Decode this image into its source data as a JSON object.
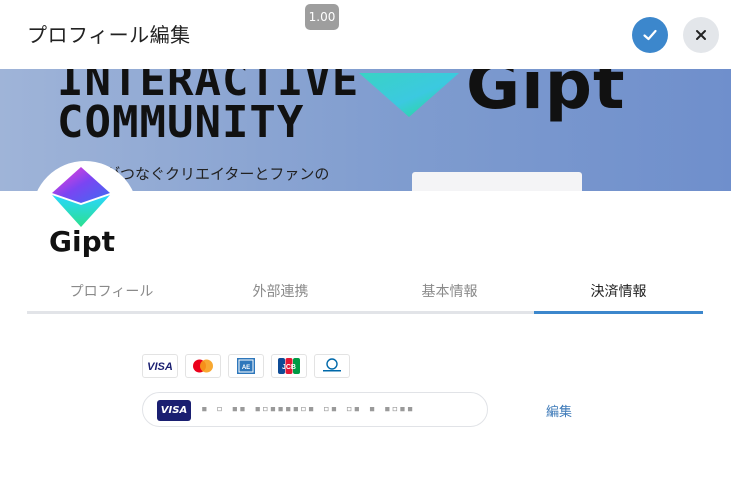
{
  "header": {
    "title": "プロフィール編集",
    "zoom_badge": "1.00",
    "confirm_icon": "check-icon",
    "close_icon": "close-icon"
  },
  "banner": {
    "line1": "INTERACTIVE",
    "line2": "COMMUNITY",
    "caption": "ギフトがつなぐクリエイターとファンの",
    "logo_text": "Gipt"
  },
  "avatar": {
    "logo_text": "Gipt"
  },
  "tabs": [
    {
      "label": "プロフィール",
      "active": false
    },
    {
      "label": "外部連携",
      "active": false
    },
    {
      "label": "基本情報",
      "active": false
    },
    {
      "label": "決済情報",
      "active": true
    }
  ],
  "payment": {
    "brands": [
      {
        "name": "VISA",
        "icon": "visa-icon"
      },
      {
        "name": "Mastercard",
        "icon": "mastercard-icon"
      },
      {
        "name": "AMEX",
        "icon": "amex-icon"
      },
      {
        "name": "JCB",
        "icon": "jcb-icon"
      },
      {
        "name": "Diners Club",
        "icon": "diners-club-icon"
      }
    ],
    "card": {
      "brand_label": "VISA",
      "number_masked": "▪ ▫ ▪▪ ▪▫▪▪▪▪▫▪ ▫▪ ▫▪ ▪ ▪▫▪▪"
    },
    "edit_label": "編集"
  },
  "colors": {
    "accent": "#3c87cc",
    "visa_blue": "#1a1f71",
    "tab_inactive": "#8a8a8a"
  }
}
